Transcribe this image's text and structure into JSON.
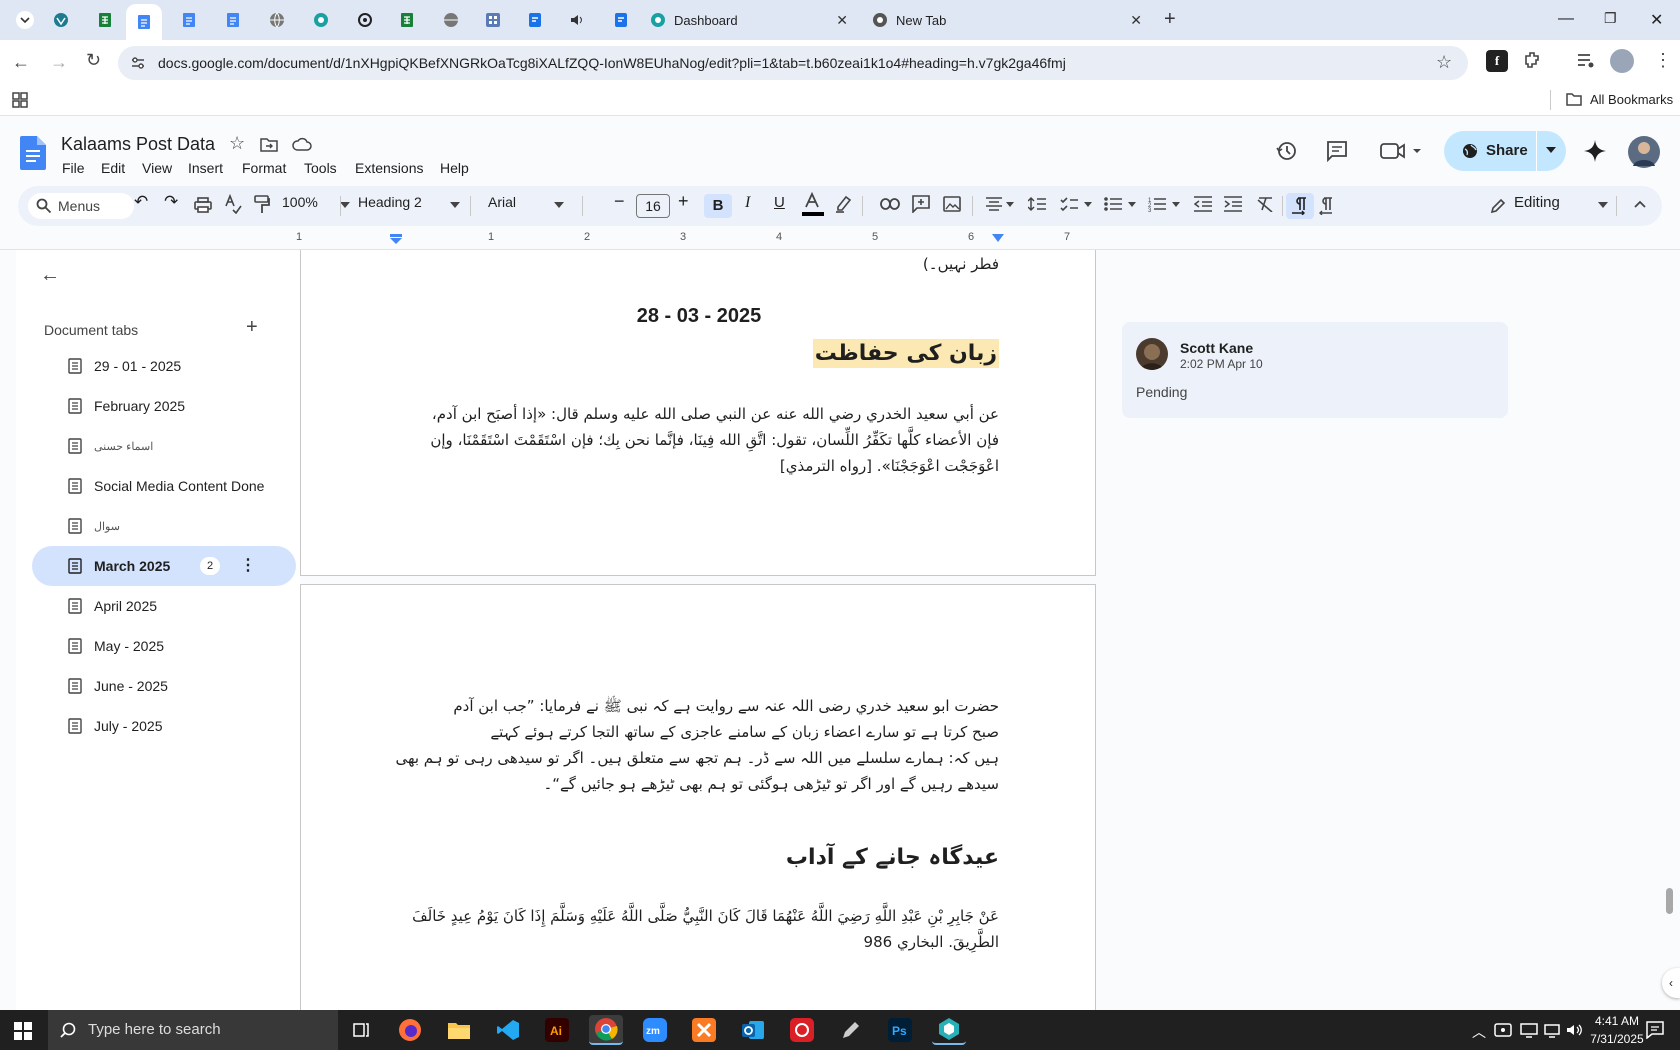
{
  "browser": {
    "tabs": [
      {
        "label": "Dashboard"
      },
      {
        "label": "New Tab"
      }
    ],
    "url": "docs.google.com/document/d/1nXHgpiQKBefXNGRkOaTcg8iXALfZQQ-IonW8EUhaNog/edit?pli=1&tab=t.b60zeai1k1o4#heading=h.v7gk2ga46fmj",
    "bookmarks_label": "All Bookmarks"
  },
  "doc": {
    "title": "Kalaams Post Data",
    "menus": [
      "File",
      "Edit",
      "View",
      "Insert",
      "Format",
      "Tools",
      "Extensions",
      "Help"
    ],
    "share_label": "Share"
  },
  "toolbar": {
    "menus_label": "Menus",
    "zoom": "100%",
    "style": "Heading 2",
    "font": "Arial",
    "font_size": "16",
    "mode": "Editing"
  },
  "ruler": {
    "ticks": [
      "1",
      "1",
      "2",
      "3",
      "4",
      "5",
      "6",
      "7"
    ]
  },
  "sidebar": {
    "heading": "Document tabs",
    "tabs": [
      {
        "label": "29 - 01 - 2025"
      },
      {
        "label": "February 2025"
      },
      {
        "label": "اسماء حسنی"
      },
      {
        "label": "Social Media Content Done"
      },
      {
        "label": "سوال"
      },
      {
        "label": "March 2025",
        "badge": "2"
      },
      {
        "label": "April 2025"
      },
      {
        "label": "May - 2025"
      },
      {
        "label": "June - 2025"
      },
      {
        "label": "July - 2025"
      }
    ]
  },
  "page1": {
    "top_fragment": "فطر نہیں۔)",
    "date": "28 - 03 - 2025",
    "heading": "زبان کی حفاظت",
    "arabic_lines": [
      "عن أبي سعيد الخدري رضي الله عنه عن النبي صلى الله عليه وسلم قال: «إذا أصبَح ابن آدم،",
      "فإن الأعضاء كلَّها تكَفِّرُ اللِّسان، تقول: اتَّقِ الله فِينَا، فإنَّما نحن بِك؛ فإن اسْتَقَمْتَ اسْتَقَمْنَا، وإن",
      "اعْوَجَجْت اعْوَجَجْنَا». [رواه الترمذي]"
    ]
  },
  "page2": {
    "urdu_lines": [
      "حضرت ابو سعيد خدري رضی اللہ عنہ سے روایت ہے کہ نبی ﷺ نے فرمایا: ”جب ابن آدم",
      "صبح کرتا ہے تو سارے اعضاء زبان کے سامنے عاجزی کے ساتھ التجا کرتے ہوئے کہتے",
      "ہیں کہ: ہمارے سلسلے میں اللہ سے ڈر۔ ہم تجھ سے متعلق ہیں۔ اگر تو سیدھی رہی تو ہم بھی",
      "سیدھے رہیں گے اور اگر تو ٹیڑھی ہوگئی تو ہم بھی ٹیڑھے ہو جائیں گے“۔"
    ],
    "heading": "عیدگاہ جانے کے آداب",
    "arabic_lines": [
      "عَنْ جَابِرِ بْنِ عَبْدِ اللَّهِ رَضِيَ اللَّهُ عَنْهُمَا قَالَ كَانَ النَّبِيُّ صَلَّى اللَّهُ عَلَيْهِ وَسَلَّمَ إِذَا كَانَ يَوْمُ عِيدٍ خَالَفَ",
      "الطَّرِيقَ. البخاري 986"
    ]
  },
  "comment": {
    "author": "Scott Kane",
    "time": "2:02 PM Apr 10",
    "status": "Pending"
  },
  "taskbar": {
    "search_placeholder": "Type here to search",
    "time": "4:41 AM",
    "date": "7/31/2025"
  },
  "colors": {
    "accent": "#0b57d0",
    "share_bg": "#c2e7ff",
    "selected_tab": "#d3e3fd",
    "highlight": "#fce8b2"
  }
}
